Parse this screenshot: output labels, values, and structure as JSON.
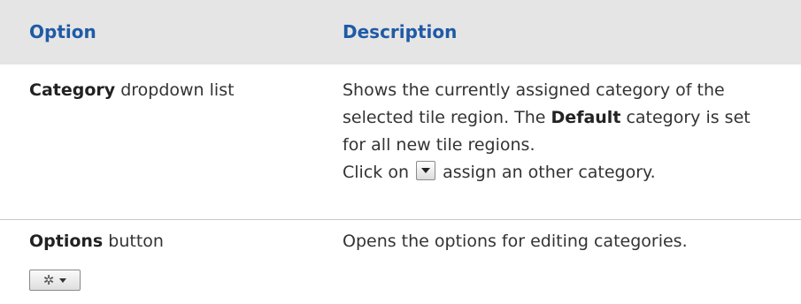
{
  "header": {
    "col1": "Option",
    "col2": "Description"
  },
  "rows": [
    {
      "option_bold": "Category",
      "option_rest": " dropdown list",
      "desc_part1": "Shows the currently assigned category of the selected tile region. The ",
      "desc_bold": "Default",
      "desc_part2": " category is set for all new tile regions.",
      "desc_line2_pre": "Click on ",
      "desc_line2_post": " assign an other category.",
      "inline_icon": "dropdown-arrow-icon"
    },
    {
      "option_bold": "Options",
      "option_rest": " button",
      "button_icons": [
        "gear-icon",
        "caret-down-icon"
      ],
      "desc": "Opens the options for editing categories."
    }
  ],
  "colors": {
    "header_bg": "#e5e5e5",
    "header_text": "#1f5aa6",
    "body_text": "#333333",
    "divider": "#c8c8c8"
  }
}
